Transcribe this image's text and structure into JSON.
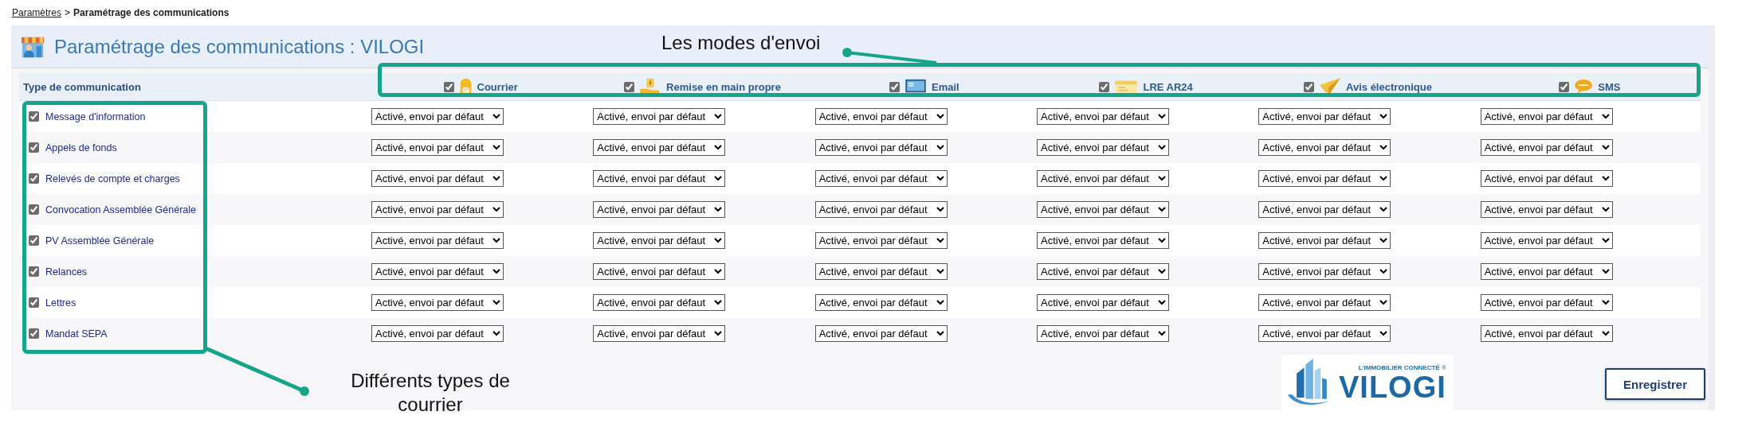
{
  "breadcrumb": {
    "link": "Paramètres",
    "separator": ">",
    "current": "Paramétrage des communications"
  },
  "page_title": "Paramétrage des communications : VILOGI",
  "table": {
    "type_header": "Type de communication",
    "columns": [
      {
        "label": "Courrier",
        "kind": "mailbox",
        "checked": true
      },
      {
        "label": "Remise en main propre",
        "kind": "hand",
        "checked": true
      },
      {
        "label": "Email",
        "kind": "monitor",
        "checked": true
      },
      {
        "label": "LRE AR24",
        "kind": "envelope",
        "checked": true
      },
      {
        "label": "Avis électronique",
        "kind": "plane",
        "checked": true
      },
      {
        "label": "SMS",
        "kind": "bubble",
        "checked": true
      }
    ],
    "rows": [
      {
        "name": "Message d'information",
        "checked": true,
        "cells": [
          "Activé, envoi par défaut",
          "Activé, envoi par défaut",
          "Activé, envoi par défaut",
          "Activé, envoi par défaut",
          "Activé, envoi par défaut",
          "Activé, envoi par défaut"
        ]
      },
      {
        "name": "Appels de fonds",
        "checked": true,
        "cells": [
          "Activé, envoi par défaut",
          "Activé, envoi par défaut",
          "Activé, envoi par défaut",
          "Activé, envoi par défaut",
          "Activé, envoi par défaut",
          "Activé, envoi par défaut"
        ]
      },
      {
        "name": "Relevés de compte et charges",
        "checked": true,
        "cells": [
          "Activé, envoi par défaut",
          "Activé, envoi par défaut",
          "Activé, envoi par défaut",
          "Activé, envoi par défaut",
          "Activé, envoi par défaut",
          "Activé, envoi par défaut"
        ]
      },
      {
        "name": "Convocation Assemblée Générale",
        "checked": true,
        "cells": [
          "Activé, envoi par défaut",
          "Activé, envoi par défaut",
          "Activé, envoi par défaut",
          "Activé, envoi par défaut",
          "Activé, envoi par défaut",
          "Activé, envoi par défaut"
        ]
      },
      {
        "name": "PV Assemblée Générale",
        "checked": true,
        "cells": [
          "Activé, envoi par défaut",
          "Activé, envoi par défaut",
          "Activé, envoi par défaut",
          "Activé, envoi par défaut",
          "Activé, envoi par défaut",
          "Activé, envoi par défaut"
        ]
      },
      {
        "name": "Relances",
        "checked": true,
        "cells": [
          "Activé, envoi par défaut",
          "Activé, envoi par défaut",
          "Activé, envoi par défaut",
          "Activé, envoi par défaut",
          "Activé, envoi par défaut",
          "Activé, envoi par défaut"
        ]
      },
      {
        "name": "Lettres",
        "checked": true,
        "cells": [
          "Activé, envoi par défaut",
          "Activé, envoi par défaut",
          "Activé, envoi par défaut",
          "Activé, envoi par défaut",
          "Activé, envoi par défaut",
          "Activé, envoi par défaut"
        ]
      },
      {
        "name": "Mandat SEPA",
        "checked": true,
        "cells": [
          "Activé, envoi par défaut",
          "Activé, envoi par défaut",
          "Activé, envoi par défaut",
          "Activé, envoi par défaut",
          "Activé, envoi par défaut",
          "Activé, envoi par défaut"
        ]
      }
    ]
  },
  "logo": {
    "tagline": "L'IMMOBILIER CONNECTÉ",
    "registered": "®",
    "name": "VILOGI"
  },
  "save_button": "Enregistrer",
  "annotations": [
    {
      "kind": "modes",
      "text": "Les modes d'envoi"
    },
    {
      "kind": "types",
      "text": "Différents types de courrier"
    }
  ]
}
